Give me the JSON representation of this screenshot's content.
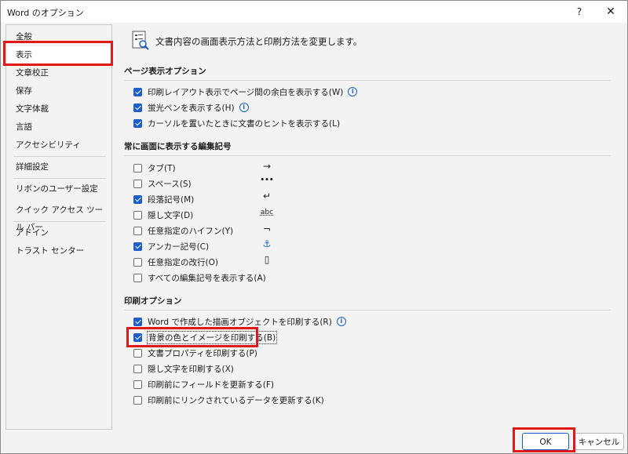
{
  "window": {
    "title": "Word のオプション",
    "help_label": "?",
    "close_label": "✕"
  },
  "sidebar": {
    "items": [
      {
        "label": "全般"
      },
      {
        "label": "表示"
      },
      {
        "label": "文章校正"
      },
      {
        "label": "保存"
      },
      {
        "label": "文字体裁"
      },
      {
        "label": "言語"
      },
      {
        "label": "アクセシビリティ"
      },
      {
        "label": "詳細設定"
      },
      {
        "label": "リボンのユーザー設定"
      },
      {
        "label": "クイック アクセス ツール バー"
      },
      {
        "label": "アドイン"
      },
      {
        "label": "トラスト センター"
      }
    ],
    "selected": "表示"
  },
  "main": {
    "header": "文書内容の画面表示方法と印刷方法を変更します。",
    "page_display": {
      "title": "ページ表示オプション",
      "options": [
        {
          "label": "印刷レイアウト表示でページ間の余白を表示する(W)",
          "checked": true
        },
        {
          "label": "蛍光ペンを表示する(H)",
          "checked": true
        },
        {
          "label": "カーソルを置いたときに文書のヒントを表示する(L)",
          "checked": true
        }
      ]
    },
    "format_marks": {
      "title": "常に画面に表示する編集記号",
      "options": [
        {
          "label": "タブ(T)",
          "checked": false,
          "symbol": "→"
        },
        {
          "label": "スペース(S)",
          "checked": false,
          "symbol": "•••"
        },
        {
          "label": "段落記号(M)",
          "checked": true,
          "symbol": "↵"
        },
        {
          "label": "隠し文字(D)",
          "checked": false,
          "symbol": "abc"
        },
        {
          "label": "任意指定のハイフン(Y)",
          "checked": false,
          "symbol": "¬"
        },
        {
          "label": "アンカー記号(C)",
          "checked": true,
          "symbol": "⚓"
        },
        {
          "label": "任意指定の改行(O)",
          "checked": false,
          "symbol": "▯"
        },
        {
          "label": "すべての編集記号を表示する(A)",
          "checked": false
        }
      ]
    },
    "print": {
      "title": "印刷オプション",
      "options": [
        {
          "label": "Word で作成した描画オブジェクトを印刷する(R)",
          "checked": true
        },
        {
          "label": "背景の色とイメージを印刷する(B)",
          "checked": true
        },
        {
          "label": "文書プロパティを印刷する(P)",
          "checked": false
        },
        {
          "label": "隠し文字を印刷する(X)",
          "checked": false
        },
        {
          "label": "印刷前にフィールドを更新する(F)",
          "checked": false
        },
        {
          "label": "印刷前にリンクされているデータを更新する(K)",
          "checked": false
        }
      ]
    }
  },
  "buttons": {
    "ok": "OK",
    "cancel": "キャンセル"
  },
  "colors": {
    "accent": "#1d5ec9",
    "highlight": "#e01818"
  }
}
